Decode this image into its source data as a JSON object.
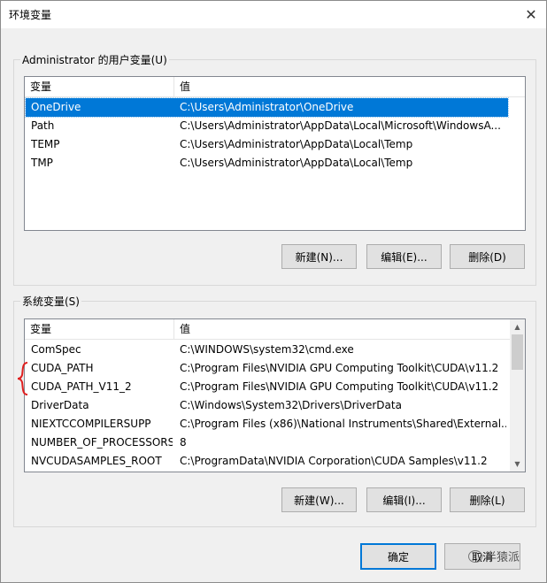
{
  "window": {
    "title": "环境变量",
    "close_glyph": "✕"
  },
  "user_vars": {
    "group_label": "Administrator 的用户变量(U)",
    "col_name": "变量",
    "col_value": "值",
    "rows": [
      {
        "name": "OneDrive",
        "value": "C:\\Users\\Administrator\\OneDrive",
        "selected": true
      },
      {
        "name": "Path",
        "value": "C:\\Users\\Administrator\\AppData\\Local\\Microsoft\\WindowsA..."
      },
      {
        "name": "TEMP",
        "value": "C:\\Users\\Administrator\\AppData\\Local\\Temp"
      },
      {
        "name": "TMP",
        "value": "C:\\Users\\Administrator\\AppData\\Local\\Temp"
      }
    ],
    "buttons": {
      "new": "新建(N)...",
      "edit": "编辑(E)...",
      "delete": "删除(D)"
    }
  },
  "system_vars": {
    "group_label": "系统变量(S)",
    "col_name": "变量",
    "col_value": "值",
    "rows": [
      {
        "name": "ComSpec",
        "value": "C:\\WINDOWS\\system32\\cmd.exe"
      },
      {
        "name": "CUDA_PATH",
        "value": "C:\\Program Files\\NVIDIA GPU Computing Toolkit\\CUDA\\v11.2"
      },
      {
        "name": "CUDA_PATH_V11_2",
        "value": "C:\\Program Files\\NVIDIA GPU Computing Toolkit\\CUDA\\v11.2"
      },
      {
        "name": "DriverData",
        "value": "C:\\Windows\\System32\\Drivers\\DriverData"
      },
      {
        "name": "NIEXTCCOMPILERSUPP",
        "value": "C:\\Program Files (x86)\\National Instruments\\Shared\\External..."
      },
      {
        "name": "NUMBER_OF_PROCESSORS",
        "value": "8"
      },
      {
        "name": "NVCUDASAMPLES_ROOT",
        "value": "C:\\ProgramData\\NVIDIA Corporation\\CUDA Samples\\v11.2"
      }
    ],
    "buttons": {
      "new": "新建(W)...",
      "edit": "编辑(I)...",
      "delete": "删除(L)"
    }
  },
  "footer": {
    "ok": "确定",
    "cancel": "取消"
  },
  "watermark": "半猿派",
  "colors": {
    "selection": "#0078d7",
    "brace": "#e02020"
  }
}
